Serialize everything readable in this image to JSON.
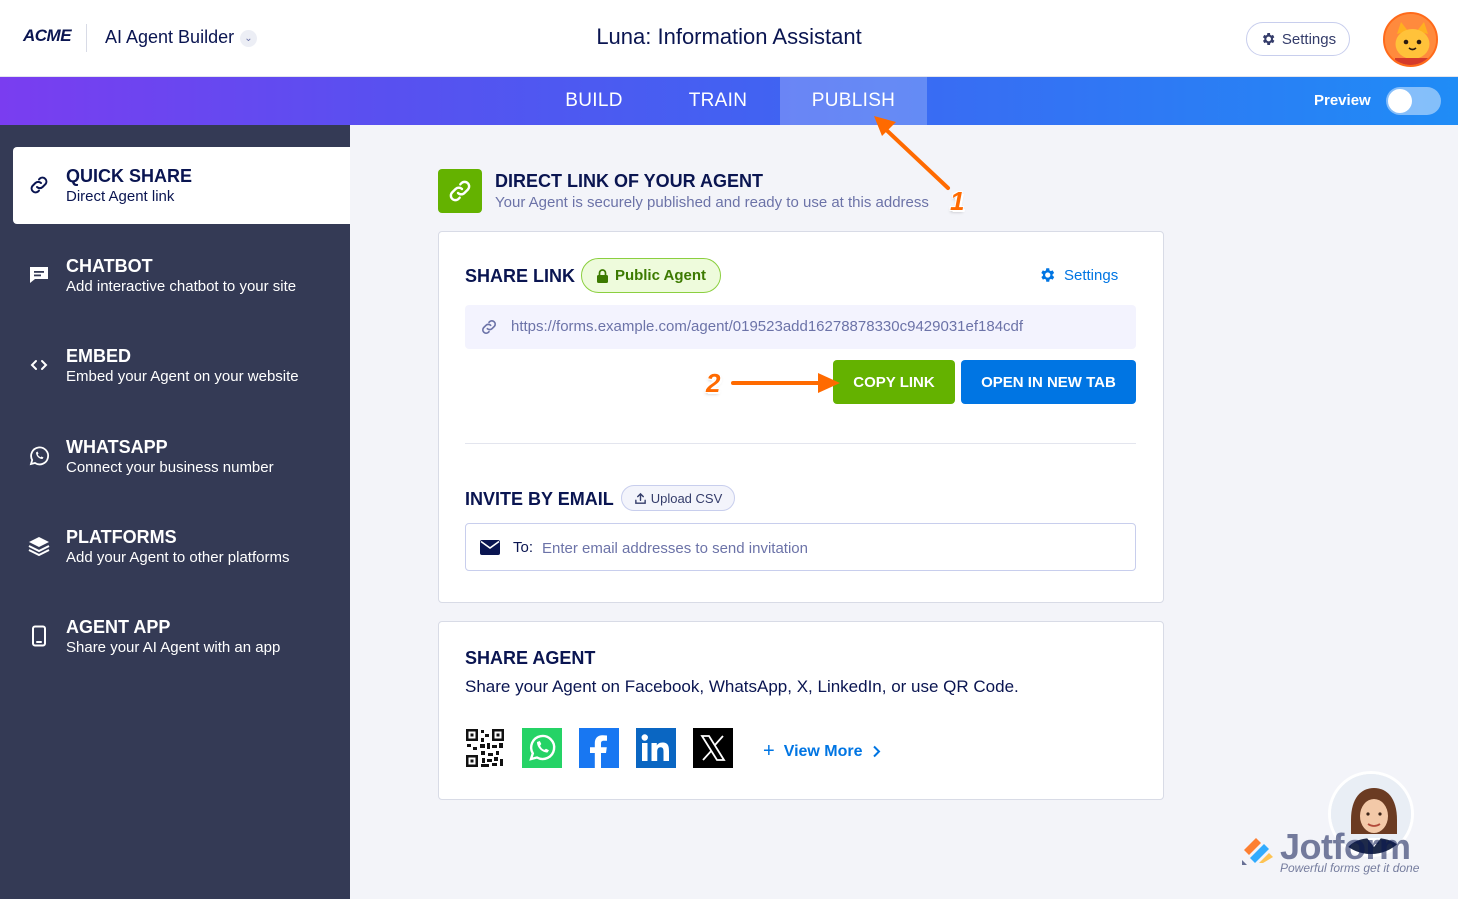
{
  "header": {
    "logo": "ACME",
    "app_name": "AI Agent Builder",
    "caret": "⌄",
    "page_title": "Luna: Information Assistant",
    "settings_label": "Settings"
  },
  "nav": {
    "tabs": [
      {
        "label": "BUILD"
      },
      {
        "label": "TRAIN"
      },
      {
        "label": "PUBLISH",
        "active": true
      }
    ],
    "preview_label": "Preview",
    "preview_on": false
  },
  "sidebar": {
    "items": [
      {
        "title": "QUICK SHARE",
        "subtitle": "Direct Agent link",
        "icon": "link-icon",
        "active": true
      },
      {
        "title": "CHATBOT",
        "subtitle": "Add interactive chatbot to your site",
        "icon": "chat-icon"
      },
      {
        "title": "EMBED",
        "subtitle": "Embed your Agent on your website",
        "icon": "code-icon"
      },
      {
        "title": "WHATSAPP",
        "subtitle": "Connect your business number",
        "icon": "whatsapp-icon"
      },
      {
        "title": "PLATFORMS",
        "subtitle": "Add your Agent to other platforms",
        "icon": "layers-icon"
      },
      {
        "title": "AGENT APP",
        "subtitle": "Share your AI Agent with an app",
        "icon": "phone-icon"
      }
    ]
  },
  "section": {
    "title": "DIRECT LINK OF YOUR AGENT",
    "subtitle": "Your Agent is securely published and ready to use at this address"
  },
  "share_link": {
    "title": "SHARE LINK",
    "badge": "Public Agent",
    "settings_label": "Settings",
    "url": "https://forms.example.com/agent/019523add16278878330c9429031ef184cdf",
    "copy_label": "COPY LINK",
    "open_label": "OPEN IN NEW TAB"
  },
  "invite": {
    "title": "INVITE BY EMAIL",
    "upload_label": "Upload CSV",
    "to_label": "To:",
    "placeholder": "Enter email addresses to send invitation"
  },
  "share_agent": {
    "title": "SHARE AGENT",
    "description": "Share your Agent on Facebook, WhatsApp, X, LinkedIn, or use QR Code.",
    "icons": [
      "qr-code-icon",
      "whatsapp-icon",
      "facebook-icon",
      "linkedin-icon",
      "x-icon"
    ],
    "view_more": "View More"
  },
  "annotations": {
    "step1": "1",
    "step2": "2"
  },
  "watermark": {
    "brand": "Jotform",
    "tagline": "Powerful forms get it done"
  },
  "colors": {
    "primary_text": "#0a1551",
    "green": "#64b200",
    "blue": "#0075e3",
    "sidebar": "#343a55",
    "annotation": "#ff6a00"
  }
}
